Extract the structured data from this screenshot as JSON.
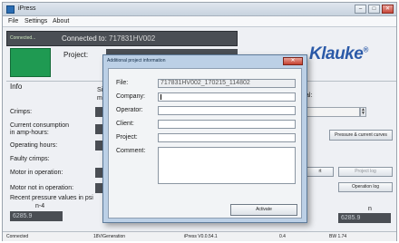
{
  "window": {
    "title": "iPress",
    "minimize": "–",
    "maximize": "□",
    "close": "✕"
  },
  "menu": {
    "items": [
      "File",
      "Settings",
      "About"
    ]
  },
  "connection": {
    "status": "Connected...",
    "connected_to_label": "Connected to:",
    "device": "717831HV002",
    "project_label": "Project:"
  },
  "logo": {
    "text": "Klauke",
    "mark": "®"
  },
  "info": {
    "title": "Info",
    "crimps_label": "Crimps:",
    "current_label_line1": "Current consumption",
    "current_label_line2": "in amp-hours:",
    "operating_hours_label": "Operating hours:",
    "faulty_crimps_label": "Faulty crimps:",
    "motor_in_op_label": "Motor in operation:",
    "motor_not_op_label": "Motor not in operation:",
    "partial_si": "Si",
    "partial_ma": "ma",
    "partial_al": "al:"
  },
  "buttons": {
    "pressure_curves": "Pressure & current curves",
    "start_partial": "rt",
    "project_log": "Project log",
    "operation_log": "Operation log"
  },
  "pressure": {
    "label": "Recent pressure values in psi",
    "n4_label": "n-4",
    "n_label": "n",
    "value_left": "6285.9",
    "value_right": "6285.9"
  },
  "status_bar": {
    "cells": [
      "Connected",
      "18V/Generation",
      "iPress V0.0.54.1",
      "0.4",
      "BW 1.74"
    ]
  },
  "dialog": {
    "title": "Additional project information",
    "close": "✕",
    "file_label": "File:",
    "file_value": "717831HV002_170215_114802",
    "company_label": "Company:",
    "company_value": "",
    "operator_label": "Operator:",
    "operator_value": "",
    "client_label": "Client:",
    "client_value": "",
    "project_label": "Project:",
    "project_value": "",
    "comment_label": "Comment:",
    "comment_value": "",
    "activate": "Activate"
  }
}
